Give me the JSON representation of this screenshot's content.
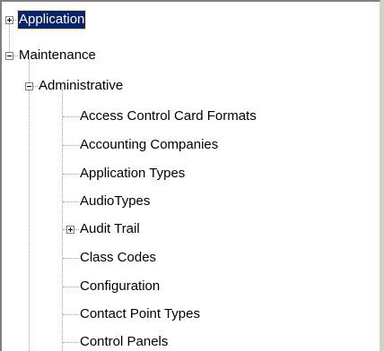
{
  "tree": {
    "application": {
      "label": "Application",
      "expanded": false,
      "selected": true
    },
    "maintenance": {
      "label": "Maintenance",
      "expanded": true,
      "administrative": {
        "label": "Administrative",
        "expanded": true,
        "items": [
          {
            "label": "Access Control Card Formats",
            "has_children": false
          },
          {
            "label": "Accounting Companies",
            "has_children": false
          },
          {
            "label": "Application Types",
            "has_children": false
          },
          {
            "label": "AudioTypes",
            "has_children": false
          },
          {
            "label": "Audit Trail",
            "has_children": true,
            "expanded": false
          },
          {
            "label": "Class Codes",
            "has_children": false
          },
          {
            "label": "Configuration",
            "has_children": false
          },
          {
            "label": "Contact Point Types",
            "has_children": false
          },
          {
            "label": "Control Panels",
            "has_children": false
          }
        ]
      }
    }
  },
  "colors": {
    "selection_bg": "#0a246a",
    "selection_fg": "#ffffff",
    "frame_shadow": "#808080",
    "face": "#d4d0c8"
  }
}
